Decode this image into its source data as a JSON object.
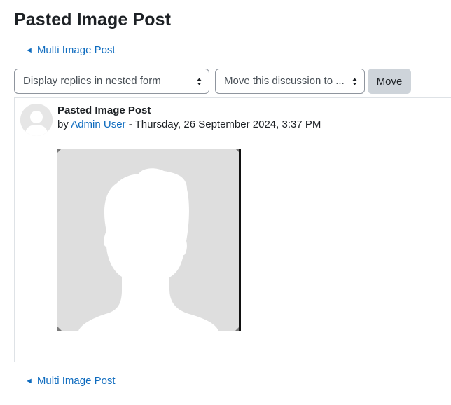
{
  "page": {
    "title": "Pasted Image Post"
  },
  "navigation": {
    "prev_arrow": "◄",
    "prev_label": "Multi Image Post"
  },
  "controls": {
    "display_mode_selected": "Display replies in nested form",
    "move_discussion_selected": "Move this discussion to ...",
    "move_button_label": "Move"
  },
  "post": {
    "subject": "Pasted Image Post",
    "by_prefix": "by",
    "author": "Admin User",
    "separator": "-",
    "date": "Thursday, 26 September 2024, 3:37 PM"
  },
  "icons": {
    "select_caret": "updown-caret-icon",
    "avatar": "default-user-icon",
    "image": "person-silhouette-image"
  },
  "colors": {
    "link": "#0f6cbf",
    "text": "#1d2125",
    "button_bg": "#ced4da",
    "border": "#dee2e6"
  }
}
